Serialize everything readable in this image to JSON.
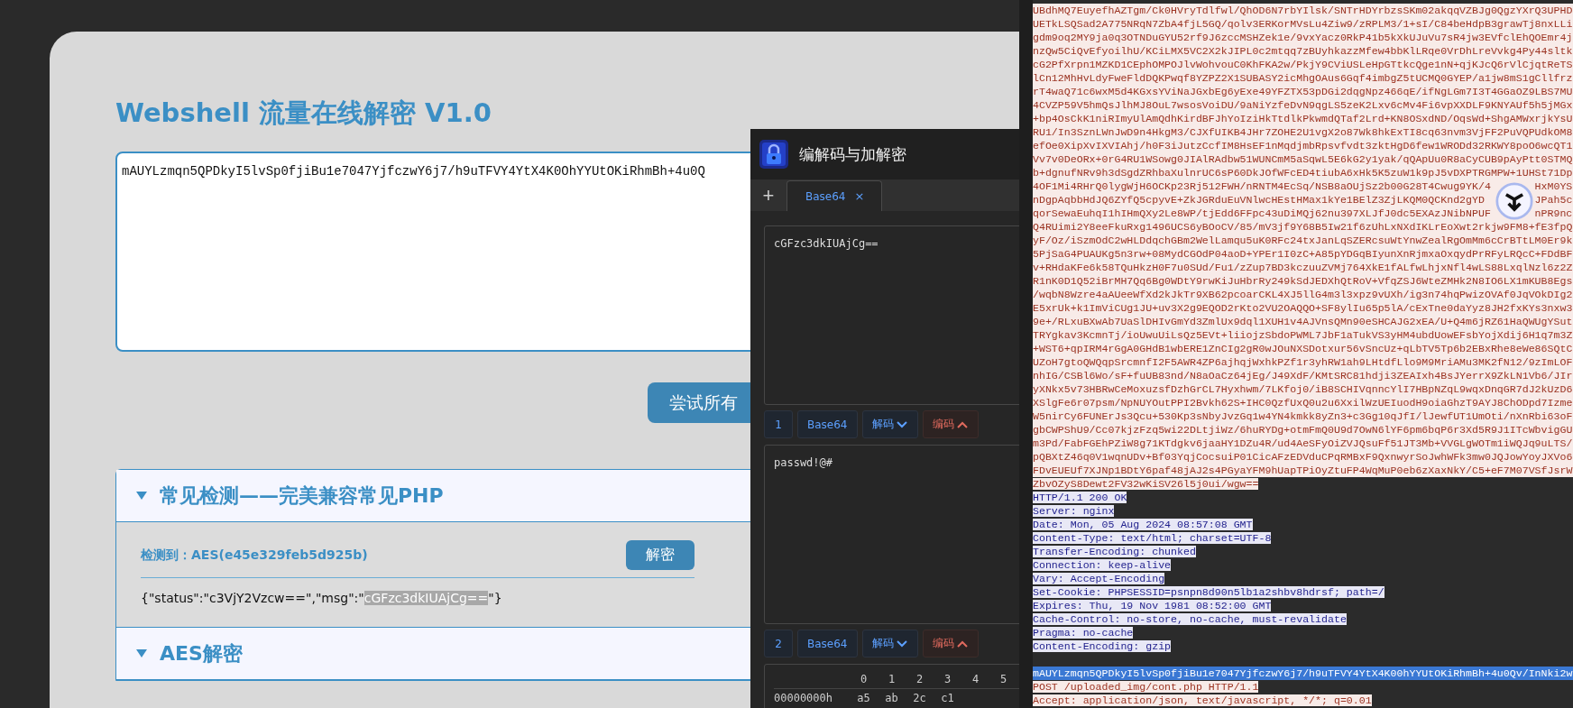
{
  "page": {
    "title": "Webshell 流量在线解密 V1.0",
    "input_value": "mAUYLzmqn5QPDkyI5lvSp0fjiBu1e7047YjfczwY6j7/h9uTFVY4YtX4K0OhYYUtOKiRhmBh+4u0Q",
    "try_all_button": "尝试所有",
    "sections": [
      {
        "title": "常见检测——完美兼容常见PHP",
        "detected": "检测到：AES(e45e329feb5d925b)",
        "decrypt_button": "解密",
        "result": [
          {
            "text": "{\"status\":\"c3VjY2Vzcw==\",\"msg\":\"",
            "selected": false
          },
          {
            "text": "cGFzc3dkIUAjCg==",
            "selected": true
          },
          {
            "text": "\"}",
            "selected": false
          }
        ]
      },
      {
        "title": "AES解密"
      }
    ]
  },
  "codec_window": {
    "title": "编解码与加解密",
    "new_tab": "+",
    "tabs": [
      {
        "label": "Base64",
        "close": "×",
        "selected": true
      }
    ],
    "panes": [
      {
        "value": "cGFzc3dkIUAjCg==",
        "index": "1",
        "codec": "Base64",
        "decode": "解码",
        "encode": "编码"
      },
      {
        "value": "passwd!@#",
        "index": "2",
        "codec": "Base64",
        "decode": "解码",
        "encode": "编码"
      }
    ],
    "hex_view": {
      "columns": [
        "0",
        "1",
        "2",
        "3",
        "4",
        "5"
      ],
      "rows": [
        {
          "offset": "00000000h",
          "bytes": [
            "a5",
            "ab",
            "2c",
            "c1"
          ]
        }
      ]
    }
  },
  "traffic_panel": {
    "lines": [
      {
        "kind": "body",
        "text": "UBdhMQ7EuyefhAZTgm/Ck0HVryTdlfwl/QhOD6N7rbYIlsk/SNTrHDYrbzsSKm02akqqVZBJg0QgzYXrQ3UPHD"
      },
      {
        "kind": "body",
        "text": "UETkLSQSad2A775NRqN7ZbA4fjL5GQ/qolv3ERKorMVsLu4Ziw9/zRPLM3/1+sI/C84beHdpB3grawTj8nxLLi"
      },
      {
        "kind": "body",
        "text": "gdm9oq2MY9ja0q3OTNDuGYU52rf9J6zccMSHZek1e/9vxYacz0RkP41b5kXkUJuVu7sR4jw3EVfclEhQOEmr4j"
      },
      {
        "kind": "body",
        "text": "nzQw5CiQvEfyoilhU/KCiLMX5VC2X2kJIPL0c2mtqq7zBUyhkazzMfew4bbKlLRqe0VrDhLreVvkg4Py44sltk"
      },
      {
        "kind": "body",
        "text": "cG2PfXrpn1MZKD1CEphOMPOJlvWohvouC0KhFKA2w/PkjY9CViUSLeHpGTtkcQge1nN+qjKJcQ6rVlCjqtReTS"
      },
      {
        "kind": "body",
        "text": "lCn12MhHvLdyFweFldDQKPwqf8YZPZ2X1SUBASY2icMhgOAus6Gqf4imbgZ5tUCMQ0GYEP/a1jw8mS1gCllfrz"
      },
      {
        "kind": "body",
        "text": "rT4waQ71c6wxM5d4KGxsYViNaJGxbEg6yExe49YFZTX53pDGi2dqgNpz466qE/ifNgLGm7I3T4GGaOZ9LBS7MU"
      },
      {
        "kind": "body",
        "text": "4CVZP59V5hmQsJlhMJ8OuL7wsosVoiDU/9aNiYzfeDvN9qgLS5zeK2Lxv6cMv4Fi6vpXXDLF9KNYAUf5h5jMGx"
      },
      {
        "kind": "body",
        "text": "+bp4OsCkK1niRImyUlAmQdhKirdBFJhYoIziHkTtdlkPkwmdQTaf2Lrd+KN8OSxdND/OqsWd+ShgAMWxrjkYsU"
      },
      {
        "kind": "body",
        "text": "RU1/In3SznLWnJwD9n4HkgM3/CJXfUIKB4JHr7ZOHE2U1vgX2o87Wk8hkExTI8cq63nvm3VjFF2PuVQPUdkOM8"
      },
      {
        "kind": "body",
        "text": "efOe0XipXvIXVIAhj/h0F3iJutzCcfIM8HsEF1nMqdjmbRpsvfvdt3zktHgD6few1WRODd32RKWY8poO6wcQT1"
      },
      {
        "kind": "body",
        "text": "Vv7v0DeORx+0rG4RU1WSowg0JIAlRAdbw51WUNCmM5aSqwL5E6kG2y1yak/qQApUu0R8aCyCUB9pAyPtt0STMQ"
      },
      {
        "kind": "body",
        "text": "b+dgnufNRv9h3dSgdZRhbaXulnrUC6sP60DkJOfWFcED4tiubA6xHk5K5zuW1k9pJ5vDXPTRGMPW+1UHSt71Dp"
      },
      {
        "kind": "body",
        "text": "4OF1Mi4RHrQ0lygWjH6OCKp23Rj512FWH/nRNTM4EcSq/NSB8aOUjSz2b00G28T4Cwug9YK/4",
        "tail": "HxM0YS"
      },
      {
        "kind": "body",
        "text": "nDgpAqbbHdJQ6ZYfQ5cpyvE+ZkJGRduEuVNlwcHEstHMax1kYe1BElZ3ZjLKQM0QCKnd2gYD",
        "tail": "JPah5c"
      },
      {
        "kind": "body",
        "text": "qorSewaEuhqI1hIHmQXy2Le8WP/tjEdd6FFpc43uDiMQj62nu397XLJfJ0dc5EXAzJNibNPUF",
        "tail": "nPR9nc"
      },
      {
        "kind": "body",
        "text": "Q4RUimi2Y8eeFkuRxg1496UCS6yBOoCV/85/mV3jf9Y68B5Iw21f6zUhLxNXdIKLrEoXwt2rkjw9FM8+fE3fpQ"
      },
      {
        "kind": "body",
        "text": "yF/Oz/iSzmOdC2wHLDdqchGBm2WelLamqu5uK0RFc24txJanLqSZERcsuWtYnwZealRgOmMm6cCrBTtLM0Er9k"
      },
      {
        "kind": "body",
        "text": "5PjSaG4PUAUKg5n3rw+08MydCGOdP04aoD+YPEr1I0zC+A85pYDGqBIyunXnRjmxaOxqydPrRFyLRQcC+FDdBF"
      },
      {
        "kind": "body",
        "text": "v+RHdaKFe6k58TQuHkzH0F7u0SUd/Fu1/zZup7BD3kczuuZVMj764XkE1fALfwLhjxNfl4wLS88LxqlNzl6z2Z"
      },
      {
        "kind": "body",
        "text": "R1nK0D1Q52iBrMH7Qq6Bg0WDtY9rwKiJuHbrRy249kSdJEDXhQtRoV+VfqZSJ6WteZMHk2N8IO6LX1mKUB8Egs"
      },
      {
        "kind": "body",
        "text": "/wqbN8Wzre4aAUeeWfXd2kJkTr9XB62pcoarCKL4XJ5llG4m3l3xpz9vUXh/ig3n74hqPwizOVAf0JqVOkDIg2"
      },
      {
        "kind": "body",
        "text": "E5xrUk+k1ImViCUg1JU+uv3X2g9EQOD2rKto2VU2OAQQO+SF8ylIu65p5lA/cExTne0daYyz8JH2fxKYs3nxw3"
      },
      {
        "kind": "body",
        "text": "9e+/RLxuBXwAb7UaSlDHIvGmYd3ZmlUx9dql1XUH1v4AJVnsQMn90eSHCAJG2xEA/U+Q4m6jRZ61HaQWUgYSut"
      },
      {
        "kind": "body",
        "text": "TRYgkav3KcmnTj/ioUwuUiLsQz5EVt+liiojzSbdoPWML7JbF1aTukVS3yHM4ubdUowEFsbYojXdij6H1q7m3Z"
      },
      {
        "kind": "body",
        "text": "+WST6+qpIRM4rGgA0GHdB1wbERE1ZnCIg2gR0wJOuNXSDotxur56vSncUz+qLbTV5Tp6b2EBxRhe8eWe86SQtC"
      },
      {
        "kind": "body",
        "text": "UZoH7gtoQWQqpSrcmnfI2F5AWR4ZP6ajhqjWxhkPZf1r3yhRW1ah9LHtdfLlo9M9MriAMu3MK2fN12/9zImLOF"
      },
      {
        "kind": "body",
        "text": "nhIG/CSBl6Wo/sF+fuUB83nd/N8aOaCz64jEg/J49XdF/KMtSRC81hdji3ZEAIxh4BsJYerrX9ZkLN1Vb6/JIr"
      },
      {
        "kind": "body",
        "text": "yXNkx5v73HBRwCeMoxuzsfDzhGrCL7Hyxhwm/7LKfoj0/iB8SCHIVqnncYlI7HBpNZqL9wqxDnqGR7dJ2kUzD6"
      },
      {
        "kind": "body",
        "text": "XSlgFe6r07psm/NpNUYOutPPI2Bvkh62S+IHC0QzfUxQ0u2u6XxilWzUEIuodH9oiaGhzT9AYJ8ChODpd7Izme"
      },
      {
        "kind": "body",
        "text": "W5nirCy6FUNErJs3Qcu+530Kp3sNbyJvzGq1w4YN4kmkk8yZn3+c3Gg10qJfI/lJewfUT1UmOti/nXnRbi63oF"
      },
      {
        "kind": "body",
        "text": "gbCWPShU9/Cc07kjzFzq5wi22DLtjiWz/6huRYDg+otmFmQ0U9d7OwN6lYF6pm6bqP6r3Xd5R9J1ITcWbvigGU"
      },
      {
        "kind": "body",
        "text": "m3Pd/FabFGEhPZiW8g71KTdgkv6jaaHY1DZu4R/ud4AeSFyOiZVJQsuFf51JT3Mb+VVGLgWOTm1iWQJq9uLTS/"
      },
      {
        "kind": "body",
        "text": "pQBXtZ46q0V1wqnUDv+Bf03YqjCocsuiP01CicAFzEDVduCPqRMBxF9QxnwyrSoJwhWFk3mw0JQJowYoyJXVo6"
      },
      {
        "kind": "body",
        "text": "FDvEUEUf7XJNp1BDtY6paf48jAJ2s4PGyaYFM9hUapTPiOyZtuFP4WqMuP0eb6zXaxNkY/C5+eF7M07VSfJsrW"
      },
      {
        "kind": "request",
        "text": "ZbvOZyS8Dewt2FV32wKiSV26l5j0ui/wgw=="
      },
      {
        "kind": "response",
        "text": "HTTP/1.1 200 OK"
      },
      {
        "kind": "response",
        "text": "Server: nginx"
      },
      {
        "kind": "response",
        "text": "Date: Mon, 05 Aug 2024 08:57:08 GMT"
      },
      {
        "kind": "response",
        "text": "Content-Type: text/html; charset=UTF-8"
      },
      {
        "kind": "response",
        "text": "Transfer-Encoding: chunked"
      },
      {
        "kind": "response",
        "text": "Connection: keep-alive"
      },
      {
        "kind": "response",
        "text": "Vary: Accept-Encoding"
      },
      {
        "kind": "response",
        "text": "Set-Cookie: PHPSESSID=psnpn8d90n5lb1a2shbv8hdrsf; path=/"
      },
      {
        "kind": "response",
        "text": "Expires: Thu, 19 Nov 1981 08:52:00 GMT"
      },
      {
        "kind": "response",
        "text": "Cache-Control: no-store, no-cache, must-revalidate"
      },
      {
        "kind": "response",
        "text": "Pragma: no-cache"
      },
      {
        "kind": "response",
        "text": "Content-Encoding: gzip"
      },
      {
        "kind": "blank"
      },
      {
        "kind": "selected",
        "text": "mAUYLzmqn5QPDkyI5lvSp0fjiBu1e7047YjfczwY6j7/h9uTFVY4YtX4K00hYYUtOKiRhmBh+4u0Qv/InNki2w"
      },
      {
        "kind": "request",
        "text": "POST /uploaded_img/cont.php HTTP/1.1"
      },
      {
        "kind": "request",
        "text": "Accept: application/json, text/javascript, */*; q=0.01"
      }
    ]
  }
}
